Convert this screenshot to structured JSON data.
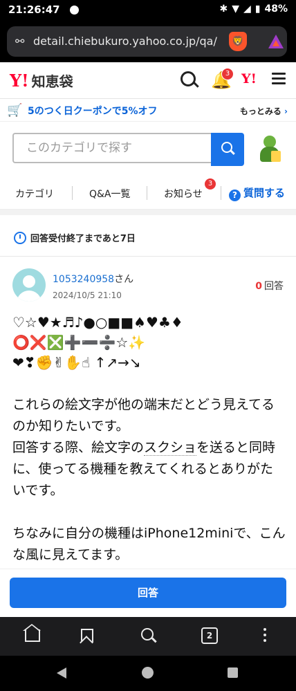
{
  "status": {
    "time": "21:26:47",
    "battery": "48%"
  },
  "browser": {
    "url": "detail.chiebukuro.yahoo.co.jp/qa/",
    "tab_count": "2"
  },
  "header": {
    "logo": "Y!",
    "logo_text": "知恵袋",
    "bell_badge": "3",
    "y_small": "Y!"
  },
  "promo": {
    "text": "5のつく日クーポンで5%オフ",
    "more": "もっとみる"
  },
  "search": {
    "placeholder": "このカテゴリで探す"
  },
  "nav": {
    "category": "カテゴリ",
    "qa": "Q&A一覧",
    "news": "お知らせ",
    "news_badge": "3",
    "ask": "質問する"
  },
  "question": {
    "deadline": "回答受付終了まであと7日",
    "user": "1053240958",
    "user_suffix": "さん",
    "date": "2024/10/5 21:10",
    "answer_count": "0",
    "answer_label": "回答",
    "emoji_lines": [
      "♡☆♥★♬♪●○■■♠♥♣♦",
      "⭕❌❎➕➖➗☆✨",
      "❤❣✊✌✋☝ ↑↗→↘"
    ],
    "para1_a": "これらの絵文字が他の端末だとどう見えてるのか知りたいです。",
    "para1_b": "回答する際、絵文字の",
    "para1_c": "スクショ",
    "para1_d": "を送ると同時に、使ってる機種を教えてくれるとありがたいです。",
    "para2": "ちなみに自分の機種はiPhone12miniで、こんな風に見えてます。"
  },
  "answer_button": "回答",
  "colors": {
    "accent": "#1a73e8",
    "brand": "#ff0033",
    "badge": "#e93536"
  }
}
